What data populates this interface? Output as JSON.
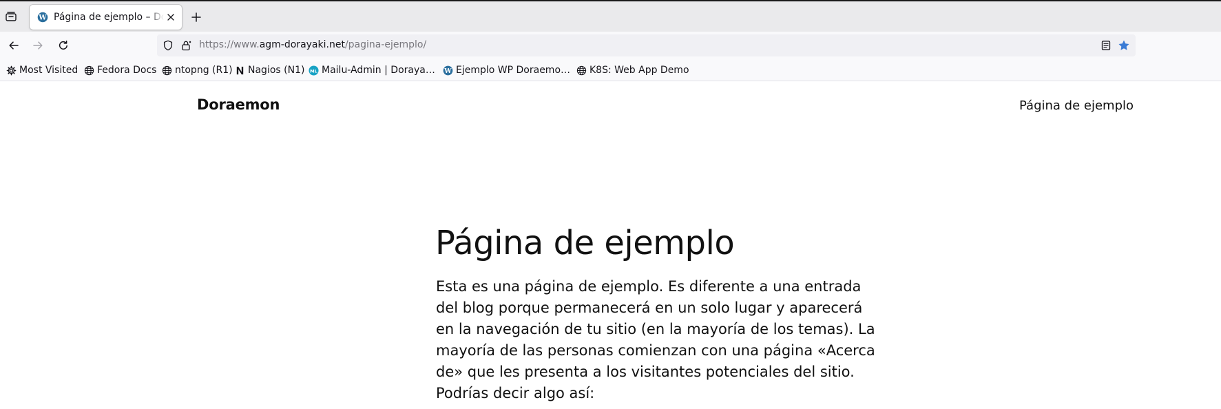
{
  "browser": {
    "tab": {
      "title": "Página de ejemplo – Doraemon"
    },
    "url": {
      "scheme": "https://www.",
      "host": "agm-dorayaki.net",
      "path": "/pagina-ejemplo/"
    },
    "bookmarks": [
      {
        "label": "Most Visited",
        "icon": "gear-icon"
      },
      {
        "label": "Fedora Docs",
        "icon": "globe-icon"
      },
      {
        "label": "ntopng (R1)",
        "icon": "globe-icon"
      },
      {
        "label": "Nagios (N1)",
        "icon": "nagios-icon"
      },
      {
        "label": "Mailu-Admin | Doraya…",
        "icon": "mailu-icon"
      },
      {
        "label": "Ejemplo WP Doraemo…",
        "icon": "wordpress-icon"
      },
      {
        "label": "K8S: Web App Demo",
        "icon": "globe-icon"
      }
    ],
    "colors": {
      "accent_star": "#3a7bd5",
      "wordpress": "#2b6f9e",
      "mailu": "#18a2c4"
    }
  },
  "site": {
    "title": "Doraemon",
    "nav_link": "Página de ejemplo"
  },
  "page": {
    "title": "Página de ejemplo",
    "body": "Esta es una página de ejemplo. Es diferente a una entrada del blog porque permanecerá en un solo lugar y aparecerá en la navegación de tu sitio (en la mayoría de los temas). La mayoría de las personas comienzan con una página «Acerca de» que les presenta a los visitantes potenciales del sitio. Podrías decir algo así:"
  }
}
